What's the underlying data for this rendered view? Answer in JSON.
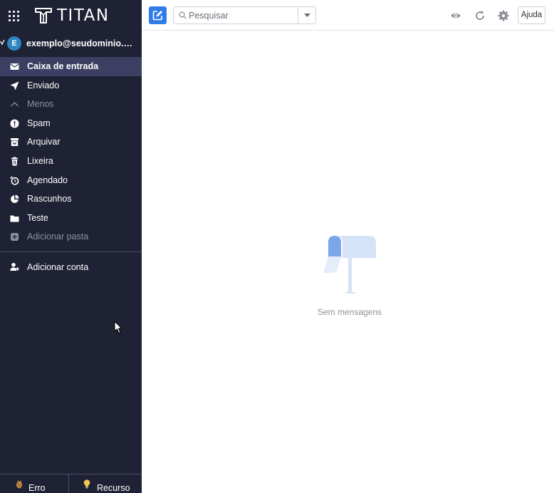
{
  "brand": {
    "name": "TITAN"
  },
  "account": {
    "initial": "E",
    "email": "exemplo@seudominio.co..."
  },
  "folders": [
    {
      "label": "Caixa de entrada",
      "icon": "envelope-icon"
    },
    {
      "label": "Enviado",
      "icon": "paper-plane-icon"
    },
    {
      "label": "Menos",
      "icon": "chevron-up-icon"
    },
    {
      "label": "Spam",
      "icon": "exclamation-circle-icon"
    },
    {
      "label": "Arquivar",
      "icon": "archive-icon"
    },
    {
      "label": "Lixeira",
      "icon": "trash-icon"
    },
    {
      "label": "Agendado",
      "icon": "alarm-clock-icon"
    },
    {
      "label": "Rascunhos",
      "icon": "draft-icon"
    },
    {
      "label": "Teste",
      "icon": "folder-icon"
    },
    {
      "label": "Adicionar pasta",
      "icon": "add-folder-icon"
    }
  ],
  "add_account": {
    "label": "Adicionar conta",
    "icon": "add-user-icon"
  },
  "footer": {
    "error_label": "Erro",
    "feature_label": "Recurso"
  },
  "search": {
    "placeholder": "Pesquisar"
  },
  "toolbar": {
    "help_label": "Ajuda"
  },
  "empty_state": {
    "message": "Sem mensagens"
  },
  "colors": {
    "sidebar_bg": "#1f2134",
    "active_item": "#3c3f62",
    "accent": "#2f7ce8"
  }
}
